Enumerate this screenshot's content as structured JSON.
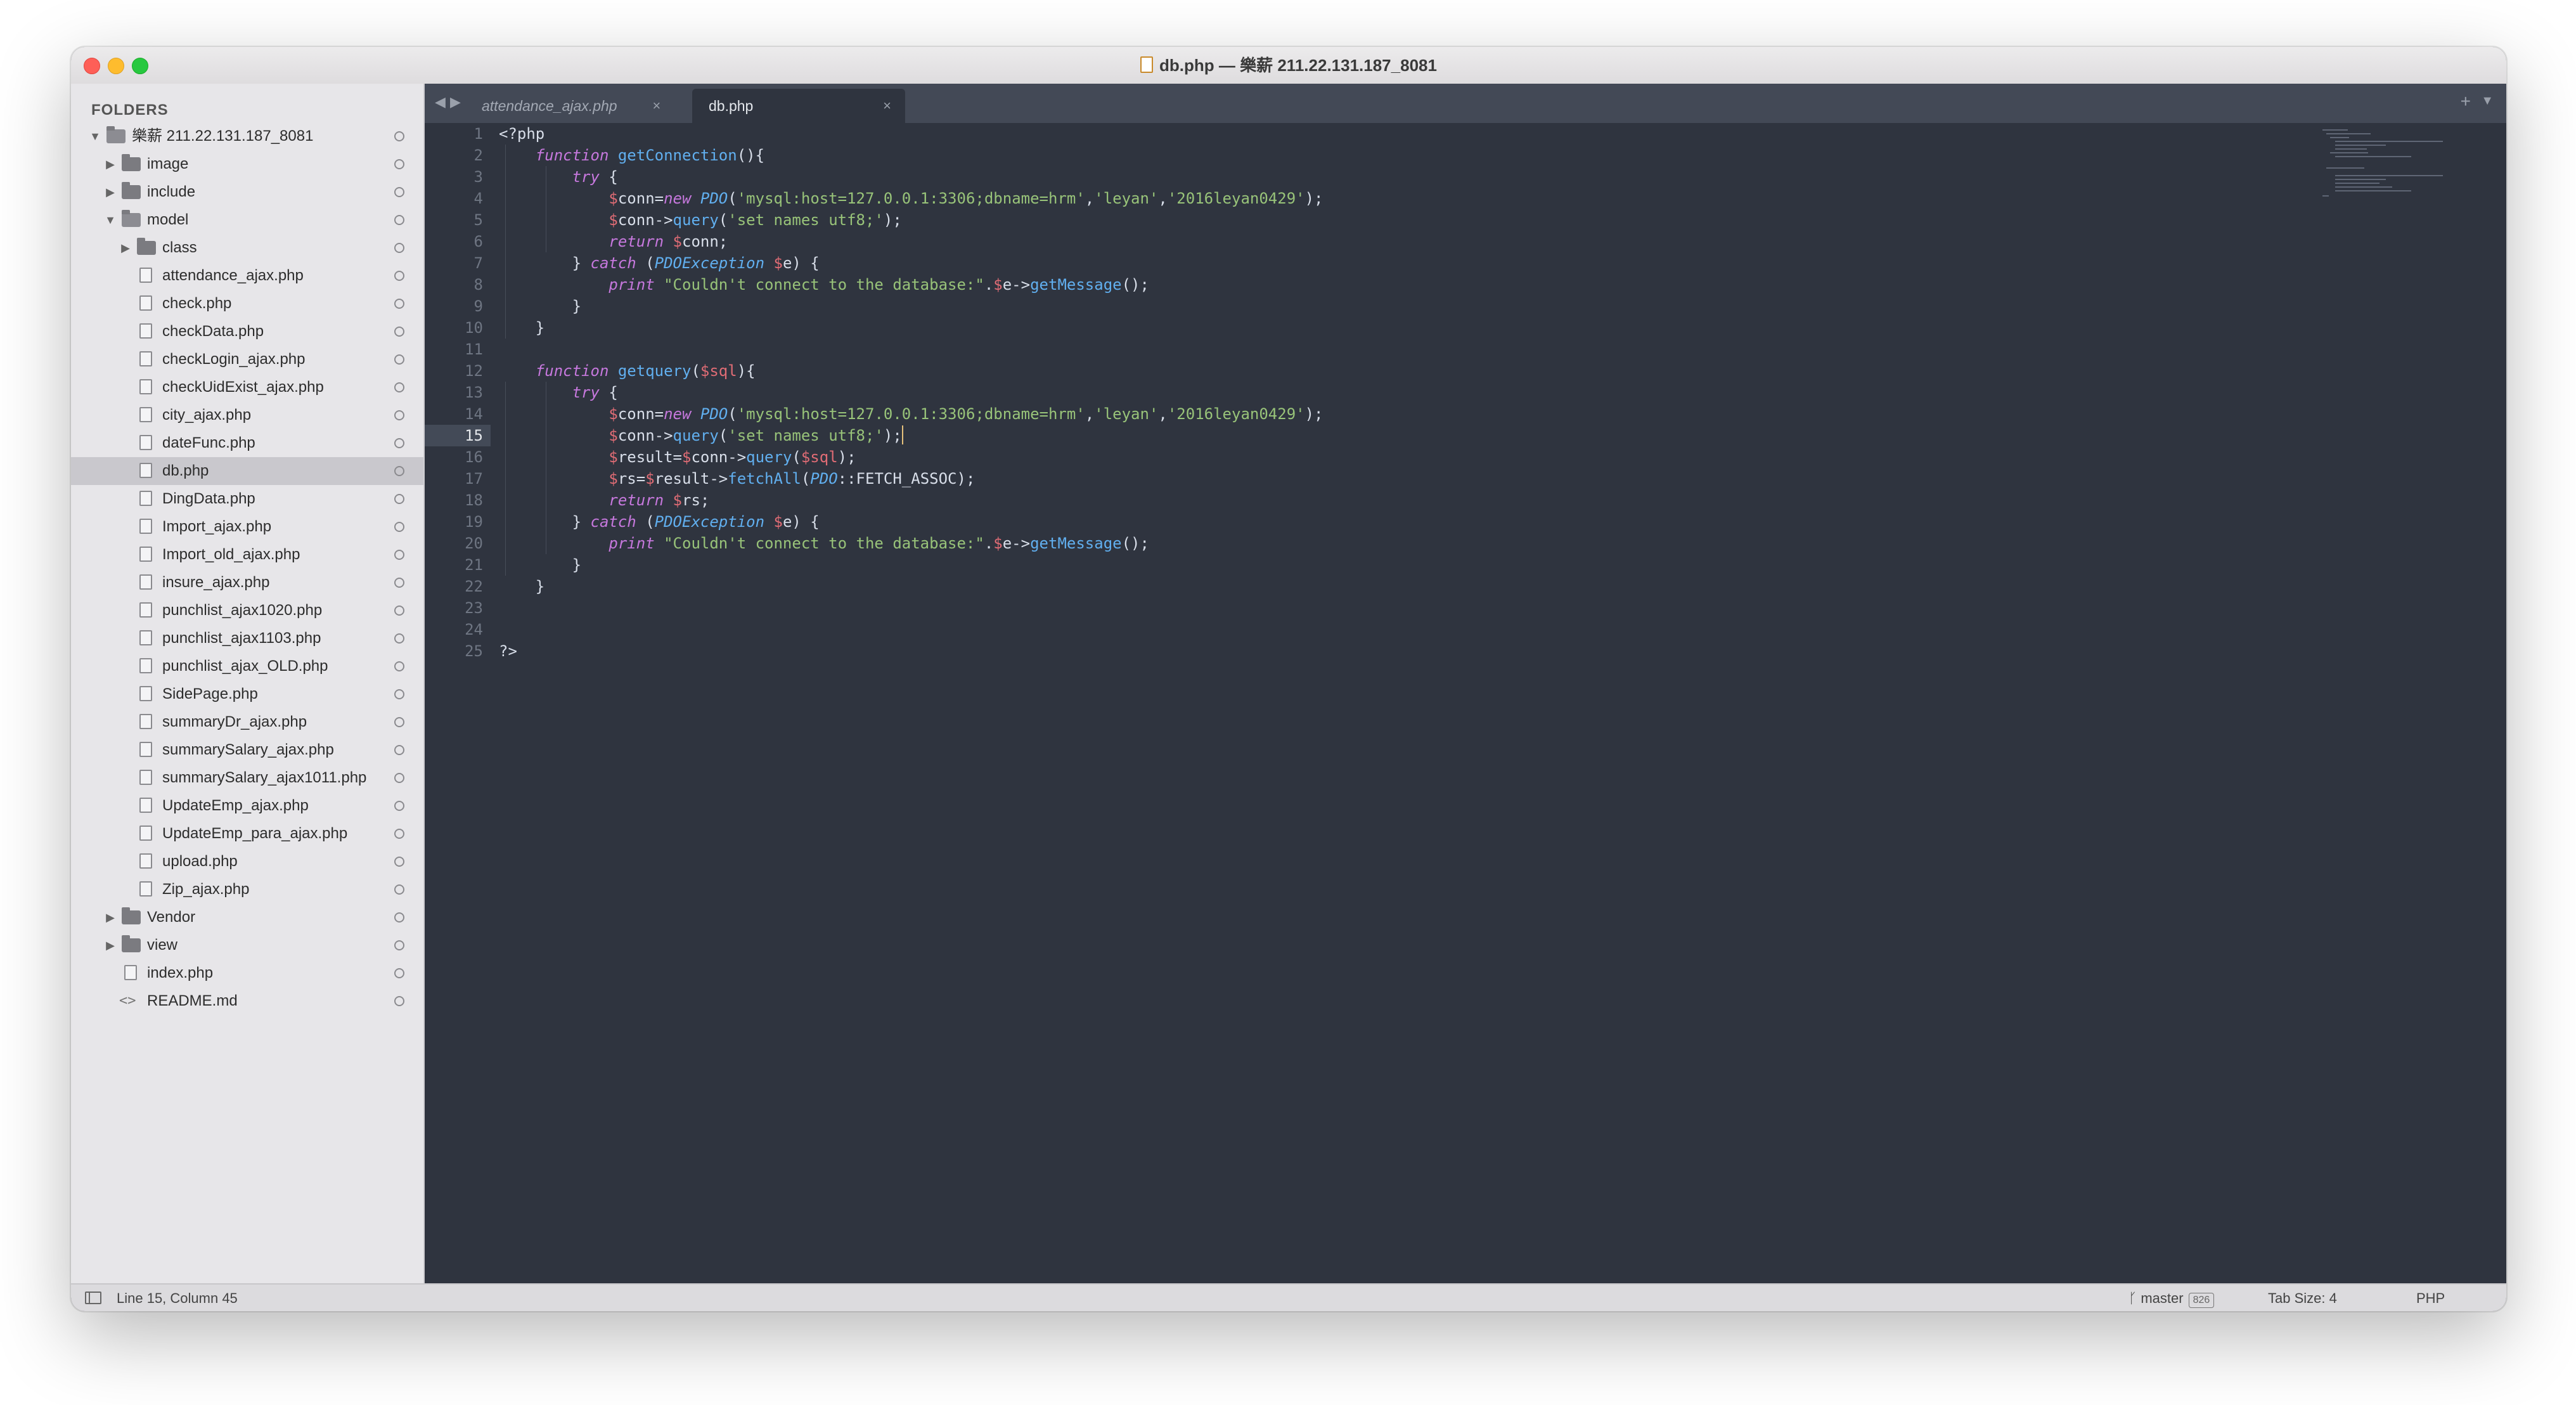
{
  "window": {
    "title": "db.php — 樂薪 211.22.131.187_8081"
  },
  "sidebar": {
    "heading": "FOLDERS",
    "items": [
      {
        "label": "樂薪 211.22.131.187_8081",
        "kind": "folder-open",
        "depth": 0
      },
      {
        "label": "image",
        "kind": "folder",
        "depth": 1
      },
      {
        "label": "include",
        "kind": "folder",
        "depth": 1
      },
      {
        "label": "model",
        "kind": "folder-open",
        "depth": 1
      },
      {
        "label": "class",
        "kind": "folder",
        "depth": 2
      },
      {
        "label": "attendance_ajax.php",
        "kind": "file",
        "depth": 2
      },
      {
        "label": "check.php",
        "kind": "file",
        "depth": 2
      },
      {
        "label": "checkData.php",
        "kind": "file",
        "depth": 2
      },
      {
        "label": "checkLogin_ajax.php",
        "kind": "file",
        "depth": 2
      },
      {
        "label": "checkUidExist_ajax.php",
        "kind": "file",
        "depth": 2
      },
      {
        "label": "city_ajax.php",
        "kind": "file",
        "depth": 2
      },
      {
        "label": "dateFunc.php",
        "kind": "file",
        "depth": 2
      },
      {
        "label": "db.php",
        "kind": "file",
        "depth": 2,
        "selected": true
      },
      {
        "label": "DingData.php",
        "kind": "file",
        "depth": 2
      },
      {
        "label": "Import_ajax.php",
        "kind": "file",
        "depth": 2
      },
      {
        "label": "Import_old_ajax.php",
        "kind": "file",
        "depth": 2
      },
      {
        "label": "insure_ajax.php",
        "kind": "file",
        "depth": 2
      },
      {
        "label": "punchlist_ajax1020.php",
        "kind": "file",
        "depth": 2
      },
      {
        "label": "punchlist_ajax1103.php",
        "kind": "file",
        "depth": 2
      },
      {
        "label": "punchlist_ajax_OLD.php",
        "kind": "file",
        "depth": 2
      },
      {
        "label": "SidePage.php",
        "kind": "file",
        "depth": 2
      },
      {
        "label": "summaryDr_ajax.php",
        "kind": "file",
        "depth": 2
      },
      {
        "label": "summarySalary_ajax.php",
        "kind": "file",
        "depth": 2
      },
      {
        "label": "summarySalary_ajax1011.php",
        "kind": "file",
        "depth": 2
      },
      {
        "label": "UpdateEmp_ajax.php",
        "kind": "file",
        "depth": 2
      },
      {
        "label": "UpdateEmp_para_ajax.php",
        "kind": "file",
        "depth": 2
      },
      {
        "label": "upload.php",
        "kind": "file",
        "depth": 2
      },
      {
        "label": "Zip_ajax.php",
        "kind": "file",
        "depth": 2
      },
      {
        "label": "Vendor",
        "kind": "folder",
        "depth": 1
      },
      {
        "label": "view",
        "kind": "folder",
        "depth": 1
      },
      {
        "label": "index.php",
        "kind": "file",
        "depth": 1
      },
      {
        "label": "README.md",
        "kind": "code",
        "depth": 1
      }
    ]
  },
  "tabs": [
    {
      "label": "attendance_ajax.php",
      "active": false
    },
    {
      "label": "db.php",
      "active": true
    }
  ],
  "tab_icons": {
    "close": "×",
    "prev": "◀",
    "next": "▶",
    "new": "+",
    "menu": "▼"
  },
  "editor": {
    "current_line": 15,
    "lines": [
      [
        [
          "pun",
          "<?php"
        ]
      ],
      [
        [
          "pun",
          "    "
        ],
        [
          "kw",
          "function"
        ],
        [
          "pun",
          " "
        ],
        [
          "fn",
          "getConnection"
        ],
        [
          "pun",
          "(){"
        ]
      ],
      [
        [
          "pun",
          "        "
        ],
        [
          "kw",
          "try"
        ],
        [
          "pun",
          " {"
        ]
      ],
      [
        [
          "pun",
          "            "
        ],
        [
          "var",
          "$"
        ],
        [
          "pun",
          "conn="
        ],
        [
          "kw",
          "new"
        ],
        [
          "pun",
          " "
        ],
        [
          "cls",
          "PDO"
        ],
        [
          "pun",
          "("
        ],
        [
          "str",
          "'mysql:host=127.0.0.1:3306;dbname=hrm'"
        ],
        [
          "pun",
          ","
        ],
        [
          "str",
          "'leyan'"
        ],
        [
          "pun",
          ","
        ],
        [
          "str",
          "'2016leyan0429'"
        ],
        [
          "pun",
          ");"
        ]
      ],
      [
        [
          "pun",
          "            "
        ],
        [
          "var",
          "$"
        ],
        [
          "pun",
          "conn->"
        ],
        [
          "fn",
          "query"
        ],
        [
          "pun",
          "("
        ],
        [
          "str",
          "'set names utf8;'"
        ],
        [
          "pun",
          ");"
        ]
      ],
      [
        [
          "pun",
          "            "
        ],
        [
          "kw",
          "return"
        ],
        [
          "pun",
          " "
        ],
        [
          "var",
          "$"
        ],
        [
          "pun",
          "conn;"
        ]
      ],
      [
        [
          "pun",
          "        } "
        ],
        [
          "kw",
          "catch"
        ],
        [
          "pun",
          " ("
        ],
        [
          "cls",
          "PDOException"
        ],
        [
          "pun",
          " "
        ],
        [
          "var",
          "$"
        ],
        [
          "pun",
          "e) {"
        ]
      ],
      [
        [
          "pun",
          "            "
        ],
        [
          "kw",
          "print"
        ],
        [
          "pun",
          " "
        ],
        [
          "str",
          "\"Couldn't connect to the database:\""
        ],
        [
          "pun",
          "."
        ],
        [
          "var",
          "$"
        ],
        [
          "pun",
          "e->"
        ],
        [
          "fn",
          "getMessage"
        ],
        [
          "pun",
          "();"
        ]
      ],
      [
        [
          "pun",
          "        }"
        ]
      ],
      [
        [
          "pun",
          "    }"
        ]
      ],
      [
        [
          "pun",
          ""
        ]
      ],
      [
        [
          "pun",
          "    "
        ],
        [
          "kw",
          "function"
        ],
        [
          "pun",
          " "
        ],
        [
          "fn",
          "getquery"
        ],
        [
          "pun",
          "("
        ],
        [
          "var",
          "$sql"
        ],
        [
          "pun",
          "){"
        ]
      ],
      [
        [
          "pun",
          "        "
        ],
        [
          "kw",
          "try"
        ],
        [
          "pun",
          " {"
        ]
      ],
      [
        [
          "pun",
          "            "
        ],
        [
          "var",
          "$"
        ],
        [
          "pun",
          "conn="
        ],
        [
          "kw",
          "new"
        ],
        [
          "pun",
          " "
        ],
        [
          "cls",
          "PDO"
        ],
        [
          "pun",
          "("
        ],
        [
          "str",
          "'mysql:host=127.0.0.1:3306;dbname=hrm'"
        ],
        [
          "pun",
          ","
        ],
        [
          "str",
          "'leyan'"
        ],
        [
          "pun",
          ","
        ],
        [
          "str",
          "'2016leyan0429'"
        ],
        [
          "pun",
          ");"
        ]
      ],
      [
        [
          "pun",
          "            "
        ],
        [
          "var",
          "$"
        ],
        [
          "pun",
          "conn->"
        ],
        [
          "fn",
          "query"
        ],
        [
          "pun",
          "("
        ],
        [
          "str",
          "'set names utf8;'"
        ],
        [
          "pun",
          ");"
        ]
      ],
      [
        [
          "pun",
          "            "
        ],
        [
          "var",
          "$"
        ],
        [
          "pun",
          "result="
        ],
        [
          "var",
          "$"
        ],
        [
          "pun",
          "conn->"
        ],
        [
          "fn",
          "query"
        ],
        [
          "pun",
          "("
        ],
        [
          "var",
          "$sql"
        ],
        [
          "pun",
          ");"
        ]
      ],
      [
        [
          "pun",
          "            "
        ],
        [
          "var",
          "$"
        ],
        [
          "pun",
          "rs="
        ],
        [
          "var",
          "$"
        ],
        [
          "pun",
          "result->"
        ],
        [
          "fn",
          "fetchAll"
        ],
        [
          "pun",
          "("
        ],
        [
          "cls",
          "PDO"
        ],
        [
          "pun",
          "::FETCH_ASSOC);"
        ]
      ],
      [
        [
          "pun",
          "            "
        ],
        [
          "kw",
          "return"
        ],
        [
          "pun",
          " "
        ],
        [
          "var",
          "$"
        ],
        [
          "pun",
          "rs;"
        ]
      ],
      [
        [
          "pun",
          "        } "
        ],
        [
          "kw",
          "catch"
        ],
        [
          "pun",
          " ("
        ],
        [
          "cls",
          "PDOException"
        ],
        [
          "pun",
          " "
        ],
        [
          "var",
          "$"
        ],
        [
          "pun",
          "e) {"
        ]
      ],
      [
        [
          "pun",
          "            "
        ],
        [
          "kw",
          "print"
        ],
        [
          "pun",
          " "
        ],
        [
          "str",
          "\"Couldn't connect to the database:\""
        ],
        [
          "pun",
          "."
        ],
        [
          "var",
          "$"
        ],
        [
          "pun",
          "e->"
        ],
        [
          "fn",
          "getMessage"
        ],
        [
          "pun",
          "();"
        ]
      ],
      [
        [
          "pun",
          "        }"
        ]
      ],
      [
        [
          "pun",
          "    }"
        ]
      ],
      [
        [
          "pun",
          ""
        ]
      ],
      [
        [
          "pun",
          ""
        ]
      ],
      [
        [
          "pun",
          "?>"
        ]
      ]
    ]
  },
  "statusbar": {
    "position": "Line 15, Column 45",
    "branch": "master",
    "branch_count": "826",
    "tab_size": "Tab Size: 4",
    "syntax": "PHP"
  }
}
